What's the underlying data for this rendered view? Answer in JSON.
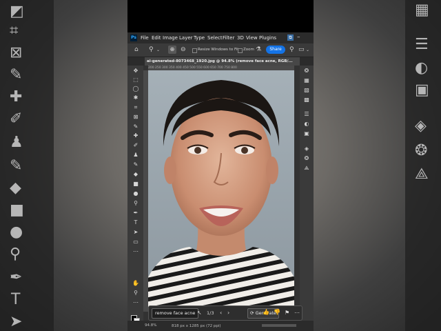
{
  "menu": {
    "items": [
      "File",
      "Edit",
      "Image",
      "Layer",
      "Type",
      "Select",
      "Filter",
      "3D",
      "View",
      "Plugins"
    ],
    "logo": "Ps"
  },
  "options_bar": {
    "resize_label": "Resize Windows to Fit",
    "zoom_label": "Zoom",
    "share_label": "Share"
  },
  "document": {
    "tab_title": "ai-generated-8073468_1920.jpg @ 94.8% (remove face acne, RGB/..."
  },
  "ruler": {
    "ticks": "200   250   300   350   400   450   500   550   600   650   700   750   800"
  },
  "taskbar": {
    "prompt_value": "remove face acne",
    "counter": "1/3",
    "generate_label": "Generate"
  },
  "status": {
    "zoom": "94.8%",
    "dimensions": "818 px x 1285 px (72 ppi)"
  },
  "icons": {
    "left_tools": [
      "move-icon",
      "marquee-icon",
      "lasso-icon",
      "quick-select-icon",
      "crop-icon",
      "frame-icon",
      "eyedropper-icon",
      "healing-brush-icon",
      "brush-icon",
      "clone-stamp-icon",
      "history-brush-icon",
      "eraser-icon",
      "gradient-icon",
      "blur-icon",
      "dodge-icon",
      "pen-icon",
      "type-icon",
      "path-select-icon",
      "rectangle-icon",
      "hand-icon",
      "zoom-icon"
    ],
    "right_tools": [
      "color-icon",
      "swatches-icon",
      "gradients-icon",
      "patterns-icon",
      "adjustments-icon",
      "properties-icon",
      "libraries-icon",
      "layers-icon",
      "channels-icon",
      "paths-icon"
    ]
  },
  "colors": {
    "accent": "#1473e6",
    "app_bg": "#323232"
  }
}
